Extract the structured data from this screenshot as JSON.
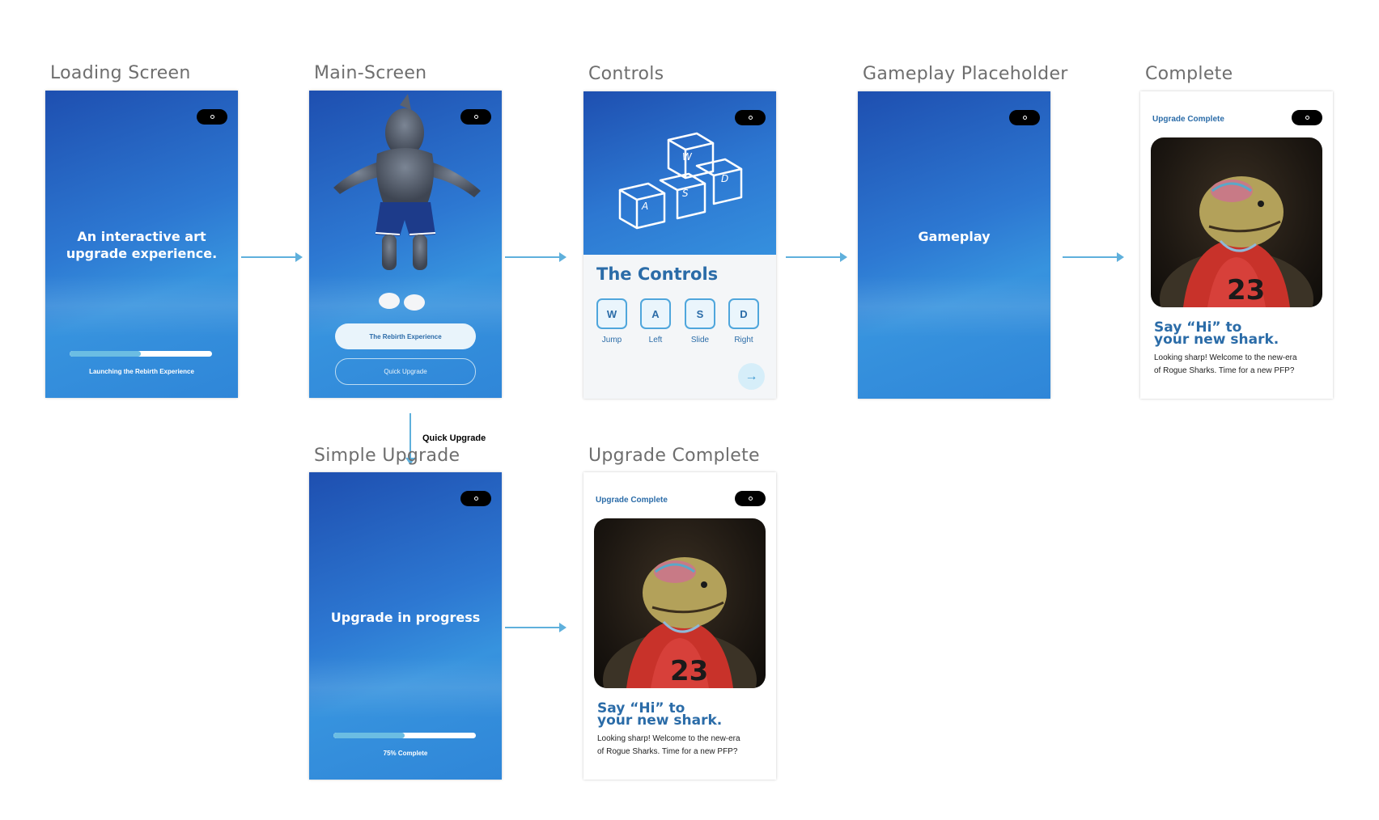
{
  "frames": {
    "loading": {
      "title": "Loading Screen",
      "headline_1": "An interactive art",
      "headline_2": "upgrade experience.",
      "progress_caption": "Launching the Rebirth Experience",
      "progress": 0.5
    },
    "main": {
      "title": "Main-Screen",
      "primary_button": "The Rebirth Experience",
      "secondary_button": "Quick Upgrade"
    },
    "controls": {
      "title": "Controls",
      "heading": "The Controls",
      "illustration_keys": [
        "W",
        "A",
        "S",
        "D"
      ],
      "keys": [
        {
          "key": "W",
          "label": "Jump"
        },
        {
          "key": "A",
          "label": "Left"
        },
        {
          "key": "S",
          "label": "Slide"
        },
        {
          "key": "D",
          "label": "Right"
        }
      ],
      "next_arrow": "→"
    },
    "gameplay": {
      "title": "Gameplay Placeholder",
      "text": "Gameplay"
    },
    "complete": {
      "title": "Complete",
      "header": "Upgrade Complete",
      "say_1": "Say “Hi” to",
      "say_2": "your new shark.",
      "body_1": "Looking sharp! Welcome to the new-era",
      "body_2": "of Rogue Sharks. Time for a new PFP?"
    },
    "simple_upgrade": {
      "title": "Simple Upgrade",
      "text": "Upgrade in progress",
      "progress_caption": "75% Complete",
      "progress": 0.5
    },
    "upgrade_complete": {
      "title": "Upgrade Complete",
      "header": "Upgrade Complete",
      "say_1": "Say “Hi” to",
      "say_2": "your new shark.",
      "body_1": "Looking sharp! Welcome to the new-era",
      "body_2": "of Rogue Sharks. Time for a new PFP?"
    }
  },
  "flow": {
    "quick_upgrade_label": "Quick Upgrade"
  },
  "colors": {
    "accent": "#2b6ca8",
    "arrow": "#5fb0dc",
    "screen_blue": "#2d78d2"
  }
}
